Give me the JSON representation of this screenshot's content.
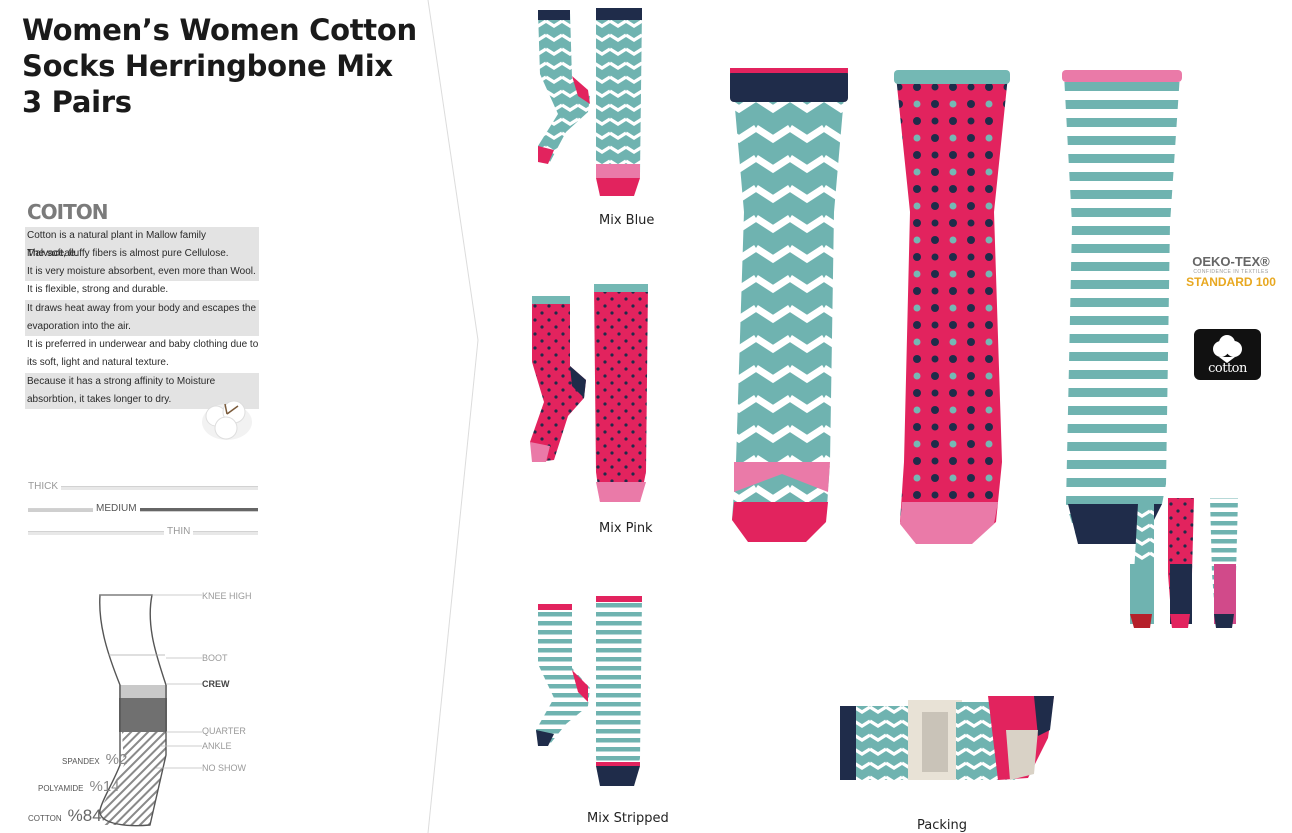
{
  "title": {
    "line1": "Women’s Women Cotton",
    "line2": "Socks Herringbone Mix",
    "line3": "3 Pairs"
  },
  "cotton_info": {
    "heading": "COITON",
    "facts": [
      "Cotton is a natural plant in Mallow family Malvaceae.",
      "The soft, fluffy fibers is almost pure Cellulose.",
      "It is very  moisture absorbent, even more than Wool.",
      "It is flexible, strong and durable.",
      "It draws heat away from your body and escapes the",
      "evaporation  into the air.",
      "It is preferred in underwear and baby clothing due to",
      "its soft, light and natural texture.",
      "Because  it has a strong affinity to Moisture",
      "absorbtion, it takes longer to dry."
    ]
  },
  "thickness": {
    "thick": "THICK",
    "medium": "MEDIUM",
    "thin": "THIN",
    "selected": "MEDIUM"
  },
  "sock_heights": {
    "knee_high": "KNEE HIGH",
    "boot": "BOOT",
    "crew": "CREW",
    "quarter": "QUARTER",
    "ankle": "ANKLE",
    "no_show": "NO SHOW",
    "selected": "CREW"
  },
  "composition": [
    {
      "name": "SPANDEX",
      "percent": "%2"
    },
    {
      "name": "POLYAMIDE",
      "percent": "%14"
    },
    {
      "name": "COTTON",
      "percent": "%84"
    }
  ],
  "variants": {
    "blue": "Mix Blue",
    "pink": "Mix Pink",
    "stripped": "Mix Stripped",
    "packing": "Packing"
  },
  "certifications": {
    "oeko_line1": "OEKO-TEX®",
    "oeko_line2": "CONFIDENCE IN TEXTILES",
    "oeko_line3": "STANDARD 100",
    "cotton_logo": "cotton"
  },
  "colors": {
    "teal": "#6fb3b0",
    "pink": "#e5235f",
    "navy": "#1f2c4a",
    "light_pink": "#ea7aa8",
    "oeko_gold": "#e8a820"
  }
}
